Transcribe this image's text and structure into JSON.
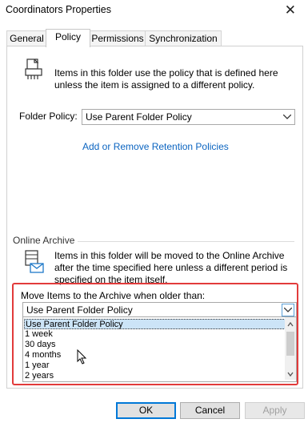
{
  "window": {
    "title": "Coordinators Properties",
    "close_glyph": "✕"
  },
  "tabs": [
    {
      "label": "General"
    },
    {
      "label": "Policy"
    },
    {
      "label": "Permissions"
    },
    {
      "label": "Synchronization"
    }
  ],
  "policy": {
    "info_text": "Items in this folder use the policy that is defined here unless the item is assigned to a different policy.",
    "folder_policy_label": "Folder Policy:",
    "folder_policy_value": "Use Parent Folder Policy",
    "retention_link": "Add or Remove Retention Policies"
  },
  "online_archive": {
    "section_label": "Online Archive",
    "info_text": "Items in this folder will be moved to the Online Archive after the time specified here unless a different period is specified on the item itself.",
    "move_label": "Move Items to the Archive when older than:",
    "selected_value": "Use Parent Folder Policy",
    "options": [
      "Use Parent Folder Policy",
      "1 week",
      "30 days",
      "4 months",
      "1 year",
      "2 years"
    ]
  },
  "buttons": {
    "ok": "OK",
    "cancel": "Cancel",
    "apply": "Apply"
  },
  "icons": {
    "printer": "printer-icon",
    "mail": "mail-archive-icon",
    "pointer": "mouse-pointer-icon"
  }
}
